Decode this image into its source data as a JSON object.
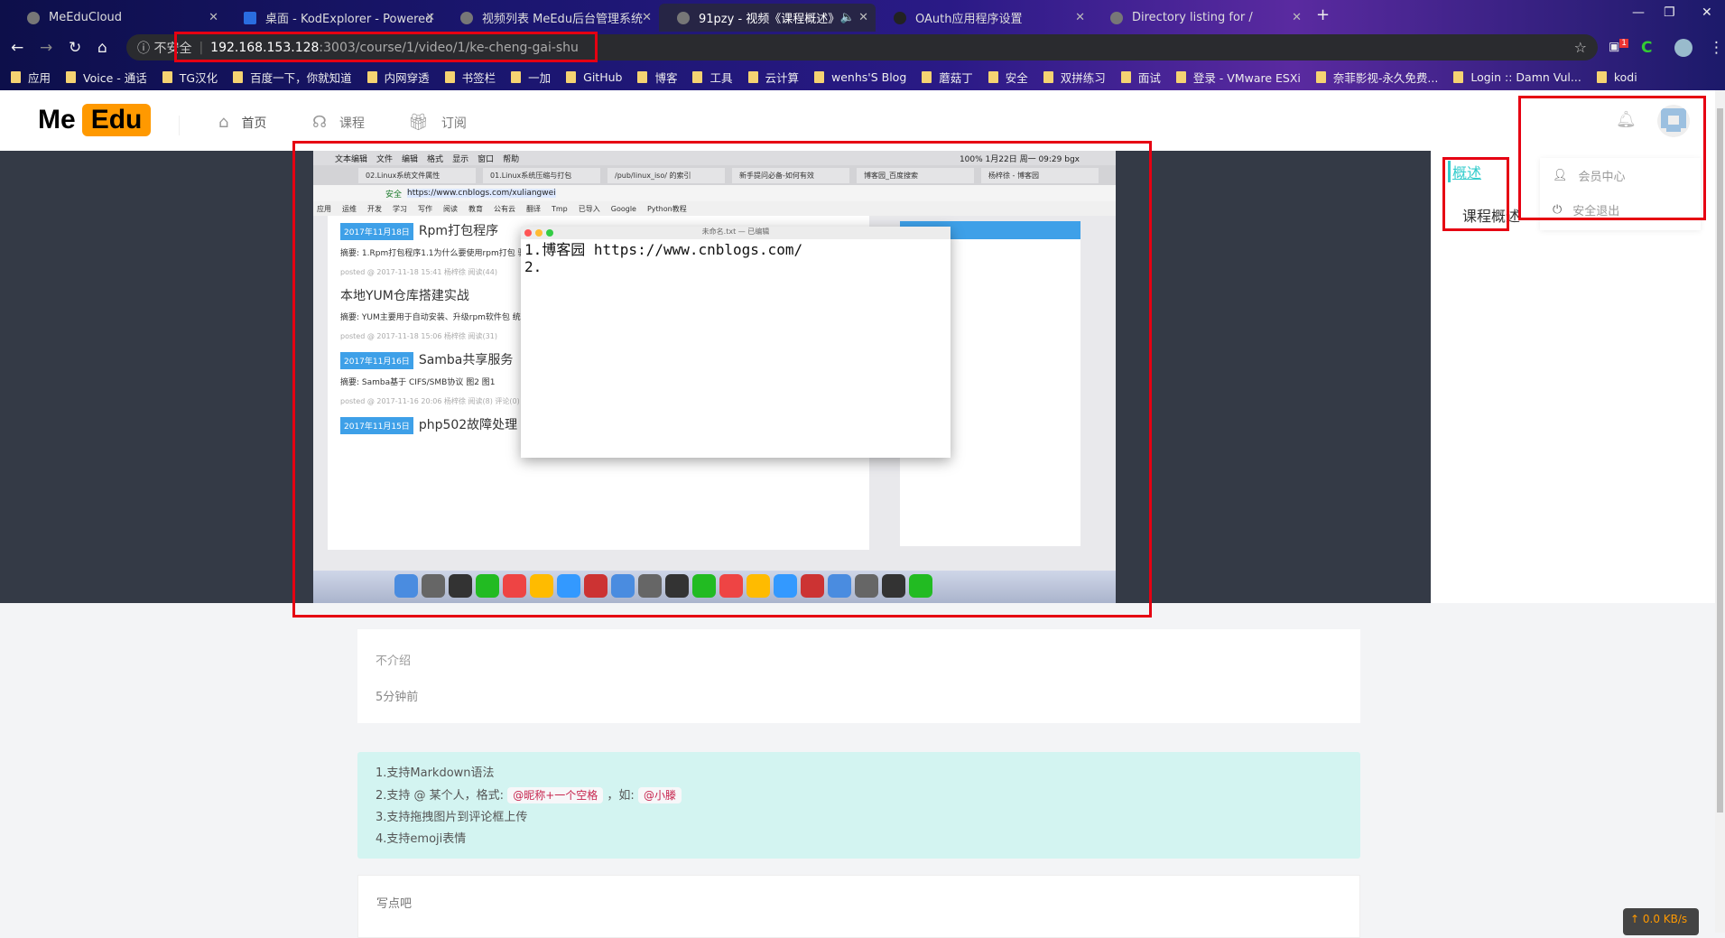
{
  "browser": {
    "tabs": [
      {
        "title": "MeEduCloud"
      },
      {
        "title": "桌面 - KodExplorer - Powered"
      },
      {
        "title": "视频列表 MeEdu后台管理系统"
      },
      {
        "title": "91pzy - 视频《课程概述》",
        "active": true
      },
      {
        "title": "OAuth应用程序设置"
      },
      {
        "title": "Directory listing for /"
      }
    ],
    "security_label": "不安全",
    "url_host": "192.168.153.128",
    "url_path": ":3003/course/1/video/1/ke-cheng-gai-shu",
    "ext_badge": "1",
    "bookmarks": [
      "应用",
      "Voice - 通话",
      "TG汉化",
      "百度一下，你就知道",
      "内网穿透",
      "书签栏",
      "一加",
      "GitHub",
      "博客",
      "工具",
      "云计算",
      "wenhs'S Blog",
      "蘑菇丁",
      "安全",
      "双拼练习",
      "面试",
      "登录 - VMware ESXi",
      "奈菲影视-永久免费...",
      "Login :: Damn Vul...",
      "kodi"
    ]
  },
  "site": {
    "logo_me": "Me",
    "logo_edu": "Edu",
    "nav": [
      {
        "label": "首页",
        "icon": "home-icon"
      },
      {
        "label": "课程",
        "icon": "headset-icon"
      },
      {
        "label": "订阅",
        "icon": "gift-icon"
      }
    ],
    "user_menu": [
      {
        "label": "会员中心",
        "icon": "user-icon"
      },
      {
        "label": "安全退出",
        "icon": "power-icon"
      }
    ]
  },
  "video": {
    "mac_menu": [
      "文本编辑",
      "文件",
      "编辑",
      "格式",
      "显示",
      "窗口",
      "帮助"
    ],
    "mac_status": "100% 1月22日 周一 09:29 bgx",
    "tabs": [
      "02.Linux系统文件属性",
      "01.Linux系统压缩与打包",
      "/pub/linux_iso/ 的索引",
      "新手提问必备-如何有效",
      "博客园_百度搜索",
      "杨梓徐 - 博客园"
    ],
    "secure": "安全",
    "url": "https://www.cnblogs.com/xuliangwei",
    "bookmarks": [
      "应用",
      "运维",
      "开发",
      "学习",
      "写作",
      "阅读",
      "教育",
      "公有云",
      "翻译",
      "Tmp",
      "已导入",
      "Google",
      "Python教程"
    ],
    "posts": [
      {
        "date": "2017年11月18日",
        "title": "Rpm打包程序",
        "summary": "摘要: 1.Rpm打包程序1.1为什么要使用rpm打包 验出适合的编译参数，诸如MySQL之类的软件 是自主性太差，软件的功能、存放位置都已经",
        "meta": "posted @ 2017-11-18 15:41 杨梓徐 阅读(44)"
      },
      {
        "date": "",
        "title": "本地YUM仓库搭建实战",
        "summary": "摘要: YUM主要用于自动安装、升级rpm软件包 统，就需要有一个包含各种rpm软件包的repo 受到网络环境的限制，导致软件安装耗时过长",
        "meta": "posted @ 2017-11-18 15:06 杨梓徐 阅读(31)"
      },
      {
        "date": "2017年11月16日",
        "title": "Samba共享服务",
        "summary": "摘要: Samba基于 CIFS/SMB协议 图2 图1",
        "meta": "posted @ 2017-11-16 20:06 杨梓徐 阅读(8) 评论(0) 编辑"
      },
      {
        "date": "2017年11月15日",
        "title": "php502故障处理",
        "summary": "",
        "meta": ""
      }
    ],
    "note_title": "未命名.txt — 已编辑",
    "note_text": "1.博客园 https://www.cnblogs.com/\n2."
  },
  "outline": {
    "heading": "概述",
    "item": "课程概述"
  },
  "info": {
    "description": "不介绍",
    "time": "5分钟前"
  },
  "tips": {
    "l1": "1.支持Markdown语法",
    "l2a": "2.支持 @ 某个人，格式:",
    "l2code1": "@昵称+一个空格",
    "l2b": "，如:",
    "l2code2": "@小滕",
    "l3": "3.支持拖拽图片到评论框上传",
    "l4": "4.支持emoji表情"
  },
  "comment": {
    "placeholder": "写点吧"
  },
  "netspeed": "↑ 0.0 KB/s",
  "colors": {
    "accent": "#33cccc",
    "logo_bg": "#ff9900",
    "annotation_red": "#e60012",
    "tips_bg": "#d3f4f1"
  }
}
